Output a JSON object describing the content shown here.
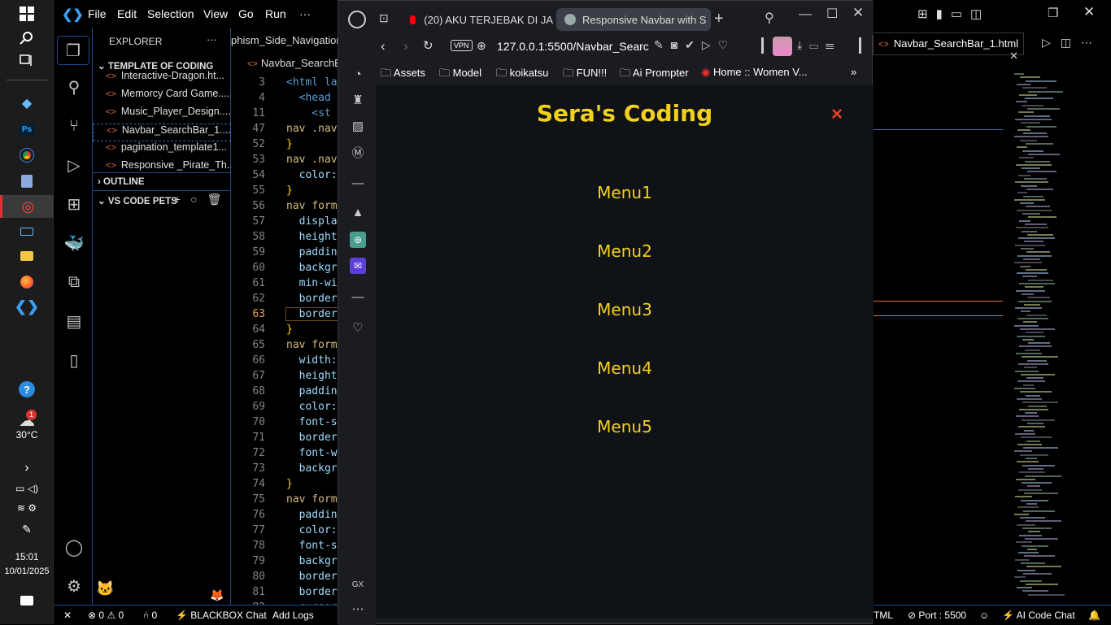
{
  "taskbar": {
    "weather_temp": "30°C",
    "weather_badge": "1",
    "time": "15:01",
    "date": "10/01/2025"
  },
  "vscode": {
    "menu": [
      "File",
      "Edit",
      "Selection",
      "View",
      "Go",
      "Run",
      "···"
    ],
    "explorer_title": "EXPLORER",
    "explorer_more": "···",
    "section_template": "TEMPLATE OF CODING",
    "files": [
      "Interactive-Dragon.ht...",
      "Memorcy Card Game....",
      "Music_Player_Design....",
      "Navbar_SearchBar_1....",
      "pagination_template1...",
      "Responsive _Pirate_Th..."
    ],
    "outline_title": "OUTLINE",
    "pets_title": "VS CODE PETS",
    "editor_tab_1": "phism_Side_Navigation_",
    "editor_tab_2": "Navbar_SearchB",
    "right_tab": "Navbar_SearchBar_1.html",
    "lines": [
      {
        "n": "3",
        "c": "<html lan"
      },
      {
        "n": "4",
        "c": "  <head"
      },
      {
        "n": "11",
        "c": "    <st"
      },
      {
        "n": "47",
        "c": "nav .nav"
      },
      {
        "n": "52",
        "c": "}"
      },
      {
        "n": "53",
        "c": "nav .nav"
      },
      {
        "n": "54",
        "c": "  color:"
      },
      {
        "n": "55",
        "c": "}"
      },
      {
        "n": "56",
        "c": "nav form"
      },
      {
        "n": "57",
        "c": "  display"
      },
      {
        "n": "58",
        "c": "  height"
      },
      {
        "n": "59",
        "c": "  padding"
      },
      {
        "n": "60",
        "c": "  backgro"
      },
      {
        "n": "61",
        "c": "  min-wid"
      },
      {
        "n": "62",
        "c": "  border"
      },
      {
        "n": "63",
        "c": "  border"
      },
      {
        "n": "64",
        "c": "}"
      },
      {
        "n": "65",
        "c": "nav form"
      },
      {
        "n": "66",
        "c": "  width:"
      },
      {
        "n": "67",
        "c": "  height"
      },
      {
        "n": "68",
        "c": "  padding"
      },
      {
        "n": "69",
        "c": "  color:"
      },
      {
        "n": "70",
        "c": "  font-s"
      },
      {
        "n": "71",
        "c": "  border"
      },
      {
        "n": "72",
        "c": "  font-we"
      },
      {
        "n": "73",
        "c": "  backgro"
      },
      {
        "n": "74",
        "c": "}"
      },
      {
        "n": "75",
        "c": "nav form"
      },
      {
        "n": "76",
        "c": "  padding"
      },
      {
        "n": "77",
        "c": "  color:"
      },
      {
        "n": "78",
        "c": "  font-s"
      },
      {
        "n": "79",
        "c": "  backgro"
      },
      {
        "n": "80",
        "c": "  border"
      },
      {
        "n": "81",
        "c": "  border"
      },
      {
        "n": "82",
        "c": "  cursor"
      }
    ],
    "status": {
      "errors": "0",
      "warnings": "0",
      "ports": "0",
      "blackbox": "BLACKBOX Chat",
      "add_logs": "Add Logs",
      "lang": "TML",
      "port": "Port : 5500",
      "ai_chat": "AI Code Chat"
    }
  },
  "browser": {
    "tab1": "(20) AKU TERJEBAK DI JA",
    "tab2": "Responsive Navbar with S",
    "url": "127.0.0.1:5500/Navbar_Searc",
    "vpn": "VPN",
    "bookmarks": [
      "Assets",
      "Model",
      "koikatsu",
      "FUN!!!",
      "Ai Prompter",
      "Home :: Women V..."
    ],
    "gx_label": "GX",
    "page": {
      "brand": "Sera's Coding",
      "close": "×",
      "menus": [
        "Menu1",
        "Menu2",
        "Menu3",
        "Menu4",
        "Menu5"
      ],
      "brand_color": "#f5d01a",
      "close_color": "#e8401c",
      "bg_color": "#0f1318"
    }
  }
}
